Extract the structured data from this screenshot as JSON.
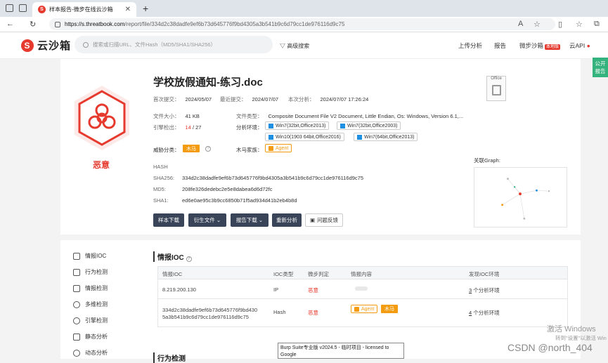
{
  "browser": {
    "tab_title": "样本报告-微步在线云沙箱",
    "tab_favicon": "S",
    "url_host": "https://s.threatbook.com",
    "url_path": "/report/file/334d2c38dadfe9ef6b73d645776f9bd4305a3b541b9c6d79cc1de976116d9c75"
  },
  "header": {
    "logo_text": "云沙箱",
    "logo_mark": "S",
    "search_placeholder": "搜索或扫描URL、文件Hash（MD5/SHA1/SHA256）",
    "advanced_search": "高级搜索",
    "nav": {
      "upload": "上传分析",
      "report": "报告",
      "weibu_sandbox": "微步沙箱",
      "badge": "本地版",
      "cloud_api": "云API"
    }
  },
  "side_badge": {
    "line1": "公开",
    "line2": "报告"
  },
  "file": {
    "title": "学校放假通知-练习.doc",
    "verdict": "恶意",
    "first_submit_label": "首次提交：",
    "first_submit": "2024/05/07",
    "last_submit_label": "最近提交：",
    "last_submit": "2024/07/07",
    "last_analysis_label": "本次分析：",
    "last_analysis": "2024/07/07 17:26:24",
    "size_label": "文件大小：",
    "size": "41 KB",
    "type_label": "文件类型：",
    "type": "Composite Document File V2 Document, Little Endian, Os: Windows, Version 6.1,...",
    "engine_label": "引擎检出：",
    "engine_hits": "14",
    "engine_total": "/ 27",
    "env_label": "分析环境：",
    "envs": [
      "Win7(32bit,Office2013)",
      "Win7(32bit,Office2003)",
      "Win10(1903 64bit,Office2016)",
      "Win7(64bit,Office2013)"
    ],
    "threat_label": "威胁分类：",
    "threat": "木马",
    "family_label": "木马家族：",
    "family": "Agent",
    "office_label": "Office",
    "hash_heading": "HASH",
    "sha256_label": "SHA256:",
    "sha256": "334d2c38dadfe9ef6b73d645776f9bd4305a3b541b9c6d79cc1de976116d9c75",
    "md5_label": "MD5:",
    "md5": "208fe326dedebc2e5e8dabea6d6d72fc",
    "sha1_label": "SHA1:",
    "sha1": "ed6e0ae95c3b9cc6850b71f5ad934d41b2eb4b8d",
    "graph_label": "关联Graph:"
  },
  "actions": [
    "样本下载",
    "衍生文件",
    "报告下载",
    "重新分析",
    "问题反馈"
  ],
  "sidenav": [
    "情报IOC",
    "行为检测",
    "情报检测",
    "多维检测",
    "引擎检测",
    "静态分析",
    "动态分析"
  ],
  "ioc": {
    "title": "情报IOC",
    "columns": [
      "情报IOC",
      "IOC类型",
      "微步判定",
      "情报内容",
      "发现IOC环境"
    ],
    "rows": [
      {
        "ioc": "8.219.200.130",
        "type": "IP",
        "verdict": "恶意",
        "env_count": "3",
        "env_text": "个分析环境"
      },
      {
        "ioc_line1": "334d2c38dadfe9ef6b73d645776f9bd430",
        "ioc_line2": "5a3b541b9c6d79cc1de976116d9c75",
        "type": "Hash",
        "verdict": "恶意",
        "tag_agent": "Agent",
        "tag_trojan": "木马",
        "env_count": "4",
        "env_text": "个分析环境"
      }
    ]
  },
  "next_section": "行为检测",
  "overlay": {
    "activate_windows": "激活 Windows",
    "activate_hint": "转到\"设置\"以激活 Win",
    "csdn": "CSDN @north_404",
    "tooltip": "Burp Suite专业版  v2024.5 - 临时项目 - licensed to Google"
  },
  "colors": {
    "danger": "#e63a2e",
    "warning": "#f39c12",
    "dark_button": "#3a4458",
    "accent_green": "#35b37e"
  }
}
